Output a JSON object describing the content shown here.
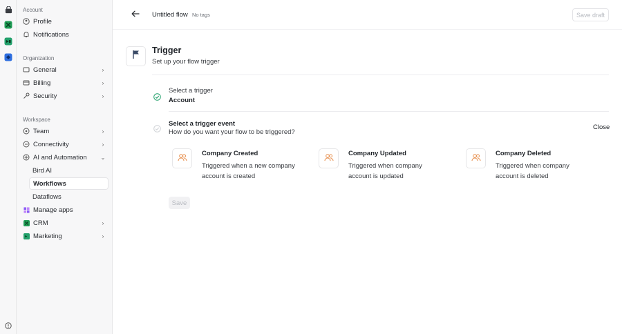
{
  "sidebar": {
    "account_section": "Account",
    "account_items": [
      {
        "label": "Profile",
        "icon": "user-circle-icon"
      },
      {
        "label": "Notifications",
        "icon": "bell-icon"
      }
    ],
    "organization_section": "Organization",
    "organization_items": [
      {
        "label": "General",
        "icon": "sliders-icon"
      },
      {
        "label": "Billing",
        "icon": "credit-card-icon"
      },
      {
        "label": "Security",
        "icon": "key-icon"
      }
    ],
    "workspace_section": "Workspace",
    "workspace_items": [
      {
        "label": "Team",
        "icon": "team-icon"
      },
      {
        "label": "Connectivity",
        "icon": "connectivity-icon"
      },
      {
        "label": "AI and Automation",
        "icon": "ai-icon"
      }
    ],
    "ai_subitems": [
      {
        "label": "Bird AI"
      },
      {
        "label": "Workflows",
        "active": true
      },
      {
        "label": "Dataflows"
      }
    ],
    "other_items": [
      {
        "label": "Manage apps",
        "icon": "apps-icon"
      },
      {
        "label": "CRM",
        "icon": "crm-icon"
      },
      {
        "label": "Marketing",
        "icon": "marketing-icon"
      }
    ]
  },
  "header": {
    "title": "Untitled flow",
    "tags": "No tags",
    "save_draft": "Save draft"
  },
  "trigger": {
    "title": "Trigger",
    "subtitle": "Set up your flow trigger"
  },
  "step1": {
    "label": "Select a trigger",
    "value": "Account"
  },
  "step2": {
    "label": "Select a trigger event",
    "subtitle": "How do you want your flow to be triggered?",
    "close": "Close"
  },
  "events": [
    {
      "title": "Company Created",
      "description": "Triggered when a new company account is created"
    },
    {
      "title": "Company Updated",
      "description": "Triggered when company account is updated"
    },
    {
      "title": "Company Deleted",
      "description": "Triggered when company account is deleted"
    }
  ],
  "save_button": "Save",
  "colors": {
    "accent_green": "#22a06b",
    "crm_green": "#1f9d55",
    "event_icon_orange": "#e8904f",
    "rail_blue": "#2f6fe0",
    "purple_apps": "#8b5cf6"
  }
}
